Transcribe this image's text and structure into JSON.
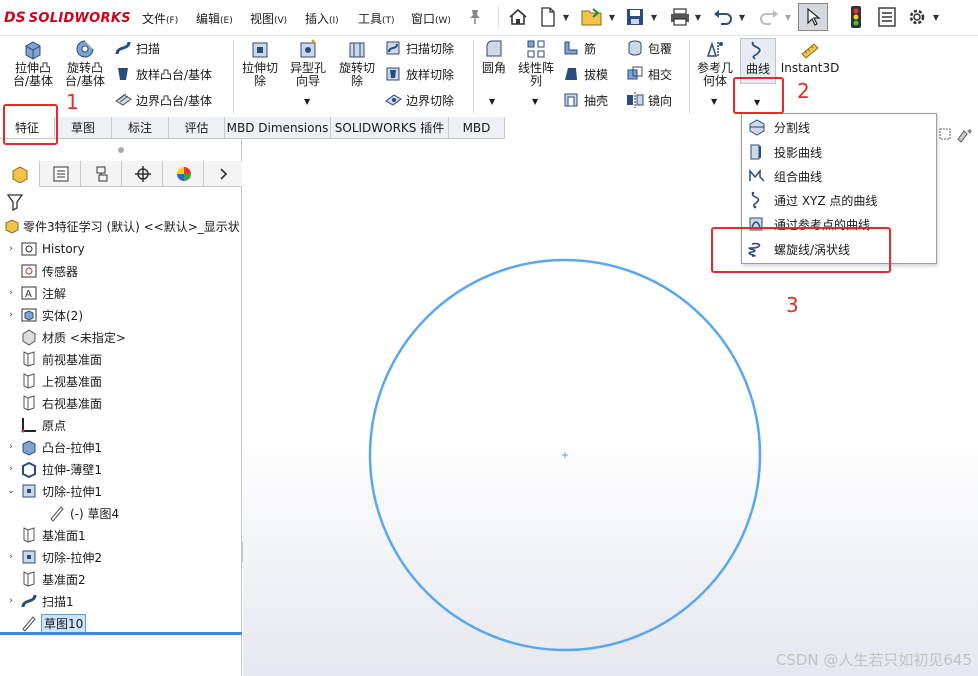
{
  "app": {
    "logo_prefix": "DS",
    "logo_text": "SOLIDWORKS"
  },
  "menu": [
    {
      "label": "文件",
      "key": "(F)"
    },
    {
      "label": "编辑",
      "key": "(E)"
    },
    {
      "label": "视图",
      "key": "(V)"
    },
    {
      "label": "插入",
      "key": "(I)"
    },
    {
      "label": "工具",
      "key": "(T)"
    },
    {
      "label": "窗口",
      "key": "(W)"
    }
  ],
  "quick_access_icons": [
    "home-icon",
    "new-document-icon",
    "open-icon",
    "save-icon",
    "print-icon",
    "undo-icon",
    "redo-icon",
    "select-icon",
    "traffic-light-icon",
    "file-properties-icon",
    "options-gear-icon"
  ],
  "toolbar": {
    "extrude_boss": "拉伸凸台/基体",
    "revolve_boss": "旋转凸台/基体",
    "sweep": "扫描",
    "loft_boss": "放样凸台/基体",
    "boundary_boss": "边界凸台/基体",
    "extrude_cut": "拉伸切除",
    "hole_wizard": "异型孔向导",
    "revolve_cut": "旋转切除",
    "sweep_cut": "扫描切除",
    "loft_cut": "放样切除",
    "boundary_cut": "边界切除",
    "fillet": "圆角",
    "linear_pattern": "线性阵列",
    "rib": "筋",
    "draft": "拔模",
    "shell": "抽壳",
    "wrap": "包覆",
    "intersect": "相交",
    "mirror": "镜向",
    "reference_geometry": "参考几何体",
    "curves": "曲线",
    "instant3d": "Instant3D"
  },
  "tabs": [
    "特征",
    "草图",
    "标注",
    "评估",
    "MBD Dimensions",
    "SOLIDWORKS 插件",
    "MBD"
  ],
  "tree": {
    "root": "零件3特征学习 (默认) <<默认>_显示状",
    "items": [
      {
        "label": "History",
        "expander": "›",
        "icon": "history-icon"
      },
      {
        "label": "传感器",
        "expander": "",
        "icon": "sensor-icon"
      },
      {
        "label": "注解",
        "expander": "›",
        "icon": "annotation-icon"
      },
      {
        "label": "实体(2)",
        "expander": "›",
        "icon": "solid-bodies-icon"
      },
      {
        "label": "材质 <未指定>",
        "expander": "",
        "icon": "material-icon"
      },
      {
        "label": "前视基准面",
        "expander": "",
        "icon": "plane-icon"
      },
      {
        "label": "上视基准面",
        "expander": "",
        "icon": "plane-icon"
      },
      {
        "label": "右视基准面",
        "expander": "",
        "icon": "plane-icon"
      },
      {
        "label": "原点",
        "expander": "",
        "icon": "origin-icon"
      },
      {
        "label": "凸台-拉伸1",
        "expander": "›",
        "icon": "boss-extrude-icon"
      },
      {
        "label": "拉伸-薄壁1",
        "expander": "›",
        "icon": "thin-extrude-icon"
      },
      {
        "label": "切除-拉伸1",
        "expander": "⌄",
        "icon": "cut-extrude-icon"
      },
      {
        "label": "(-) 草图4",
        "expander": "",
        "icon": "sketch-icon"
      },
      {
        "label": "基准面1",
        "expander": "",
        "icon": "plane-icon"
      },
      {
        "label": "切除-拉伸2",
        "expander": "›",
        "icon": "cut-extrude-icon"
      },
      {
        "label": "基准面2",
        "expander": "",
        "icon": "plane-icon"
      },
      {
        "label": "扫描1",
        "expander": "›",
        "icon": "sweep-icon"
      },
      {
        "label": "草图10",
        "expander": "",
        "icon": "sketch-icon"
      }
    ]
  },
  "curves_menu": [
    {
      "label": "分割线",
      "icon": "split-line-icon"
    },
    {
      "label": "投影曲线",
      "icon": "projected-curve-icon"
    },
    {
      "label": "组合曲线",
      "icon": "composite-curve-icon"
    },
    {
      "label": "通过 XYZ 点的曲线",
      "icon": "curve-through-xyz-icon"
    },
    {
      "label": "通过参考点的曲线",
      "icon": "curve-through-reference-points-icon"
    },
    {
      "label": "螺旋线/涡状线",
      "icon": "helix-spiral-icon"
    }
  ],
  "annotations": {
    "step1": "1",
    "step2": "2",
    "step3": "3"
  },
  "watermark": "CSDN @人生若只如初见645",
  "colors": {
    "accent": "#3a8ee6",
    "annotation_red": "#e52a2a",
    "sketch_circle": "#5aa7ee",
    "logo_red": "#d0021b"
  }
}
